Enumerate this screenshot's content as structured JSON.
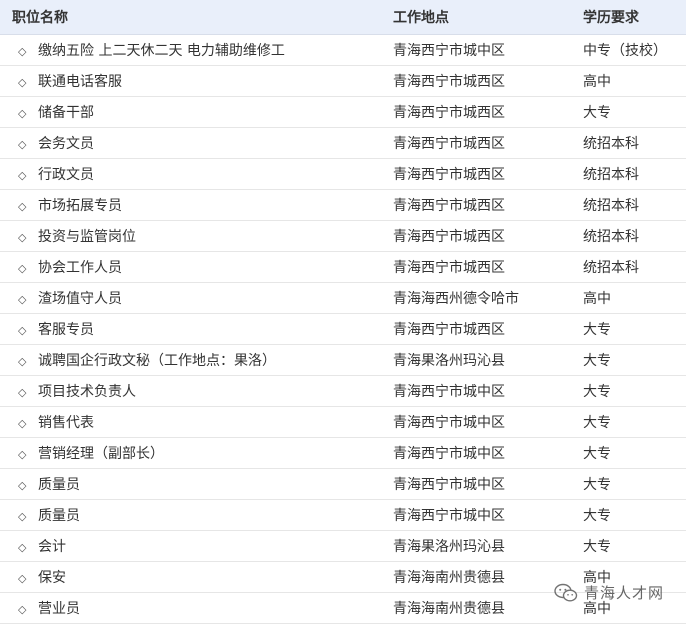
{
  "table": {
    "headers": {
      "title": "职位名称",
      "location": "工作地点",
      "education": "学历要求"
    },
    "rows": [
      {
        "title": "缴纳五险 上二天休二天 电力辅助维修工",
        "location": "青海西宁市城中区",
        "education": "中专（技校）"
      },
      {
        "title": "联通电话客服",
        "location": "青海西宁市城西区",
        "education": "高中"
      },
      {
        "title": "储备干部",
        "location": "青海西宁市城西区",
        "education": "大专"
      },
      {
        "title": "会务文员",
        "location": "青海西宁市城西区",
        "education": "统招本科"
      },
      {
        "title": "行政文员",
        "location": "青海西宁市城西区",
        "education": "统招本科"
      },
      {
        "title": "市场拓展专员",
        "location": "青海西宁市城西区",
        "education": "统招本科"
      },
      {
        "title": "投资与监管岗位",
        "location": "青海西宁市城西区",
        "education": "统招本科"
      },
      {
        "title": "协会工作人员",
        "location": "青海西宁市城西区",
        "education": "统招本科"
      },
      {
        "title": "渣场值守人员",
        "location": "青海海西州德令哈市",
        "education": "高中"
      },
      {
        "title": "客服专员",
        "location": "青海西宁市城西区",
        "education": "大专"
      },
      {
        "title": "诚聘国企行政文秘（工作地点：果洛）",
        "location": "青海果洛州玛沁县",
        "education": "大专"
      },
      {
        "title": "项目技术负责人",
        "location": "青海西宁市城中区",
        "education": "大专"
      },
      {
        "title": "销售代表",
        "location": "青海西宁市城中区",
        "education": "大专"
      },
      {
        "title": "营销经理（副部长）",
        "location": "青海西宁市城中区",
        "education": "大专"
      },
      {
        "title": "质量员",
        "location": "青海西宁市城中区",
        "education": "大专"
      },
      {
        "title": "质量员",
        "location": "青海西宁市城中区",
        "education": "大专"
      },
      {
        "title": "会计",
        "location": "青海果洛州玛沁县",
        "education": "大专"
      },
      {
        "title": "保安",
        "location": "青海海南州贵德县",
        "education": "高中"
      },
      {
        "title": "营业员",
        "location": "青海海南州贵德县",
        "education": "高中"
      }
    ]
  },
  "watermark": {
    "text": "青海人才网",
    "icon": "wechat-icon"
  },
  "colors": {
    "header_bg": "#e9effa",
    "text": "#333333",
    "divider": "#e6e6e6"
  }
}
